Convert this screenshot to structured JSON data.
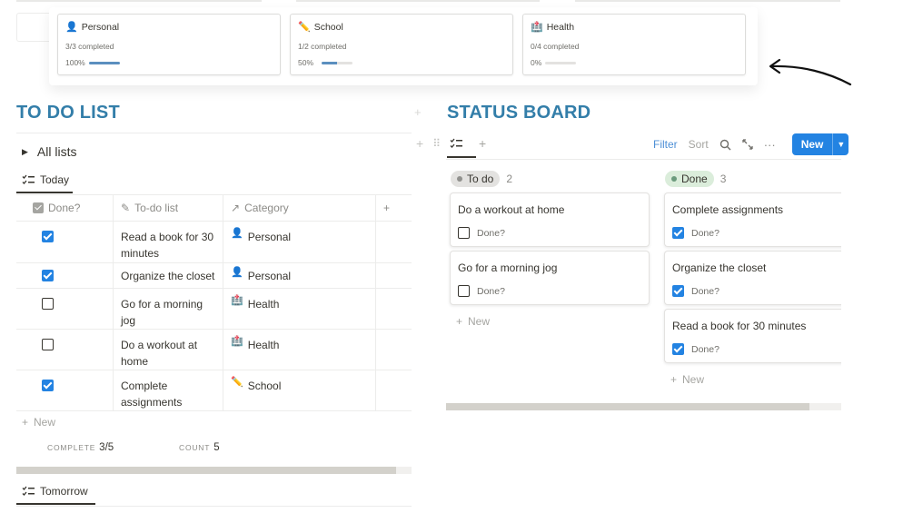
{
  "gallery": [
    {
      "icon": "person-icon",
      "emoji": "👤",
      "name": "Personal",
      "completed": "3/3 completed",
      "percent": "100%",
      "progress": 1.0
    },
    {
      "icon": "pencil-icon",
      "emoji": "✏️",
      "name": "School",
      "completed": "1/2 completed",
      "percent": "50%",
      "progress": 0.5
    },
    {
      "icon": "hospital-icon",
      "emoji": "🏥",
      "name": "Health",
      "completed": "0/4 completed",
      "percent": "0%",
      "progress": 0.0
    }
  ],
  "todo": {
    "title": "TO DO LIST",
    "all_lists": "All lists",
    "view_today": "Today",
    "view_tomorrow": "Tomorrow",
    "columns": {
      "done": "Done?",
      "todo": "To-do list",
      "category": "Category",
      "add": "+"
    },
    "rows": [
      {
        "done": true,
        "task": "Read a book for 30 minutes",
        "category": "Personal",
        "cat_emoji": "👤"
      },
      {
        "done": true,
        "task": "Organize the closet",
        "category": "Personal",
        "cat_emoji": "👤"
      },
      {
        "done": false,
        "task": "Go for a morning jog",
        "category": "Health",
        "cat_emoji": "🏥"
      },
      {
        "done": false,
        "task": "Do a workout at home",
        "category": "Health",
        "cat_emoji": "🏥"
      },
      {
        "done": true,
        "task": "Complete assignments",
        "category": "School",
        "cat_emoji": "✏️"
      }
    ],
    "new_label": "New",
    "footer": {
      "complete_label": "COMPLETE",
      "complete_value": "3/5",
      "count_label": "COUNT",
      "count_value": "5"
    }
  },
  "board": {
    "title": "STATUS BOARD",
    "toolbar": {
      "filter": "Filter",
      "sort": "Sort",
      "new": "New"
    },
    "columns": [
      {
        "name": "To do",
        "count": "2",
        "pill_color": "#e3e2e0",
        "dot_color": "#91918e",
        "cards": [
          {
            "title": "Do a workout at home",
            "done_label": "Done?",
            "done": false
          },
          {
            "title": "Go for a morning jog",
            "done_label": "Done?",
            "done": false
          }
        ],
        "new_label": "New"
      },
      {
        "name": "Done",
        "count": "3",
        "pill_color": "#dbeddb",
        "dot_color": "#6c9b7d",
        "cards": [
          {
            "title": "Complete assignments",
            "done_label": "Done?",
            "done": true
          },
          {
            "title": "Organize the closet",
            "done_label": "Done?",
            "done": true
          },
          {
            "title": "Read a book for 30 minutes",
            "done_label": "Done?",
            "done": true
          }
        ],
        "new_label": "New"
      }
    ]
  },
  "colors": {
    "heading": "#337ea9",
    "accent": "#2383e2",
    "progress": "#5b8fbf"
  }
}
